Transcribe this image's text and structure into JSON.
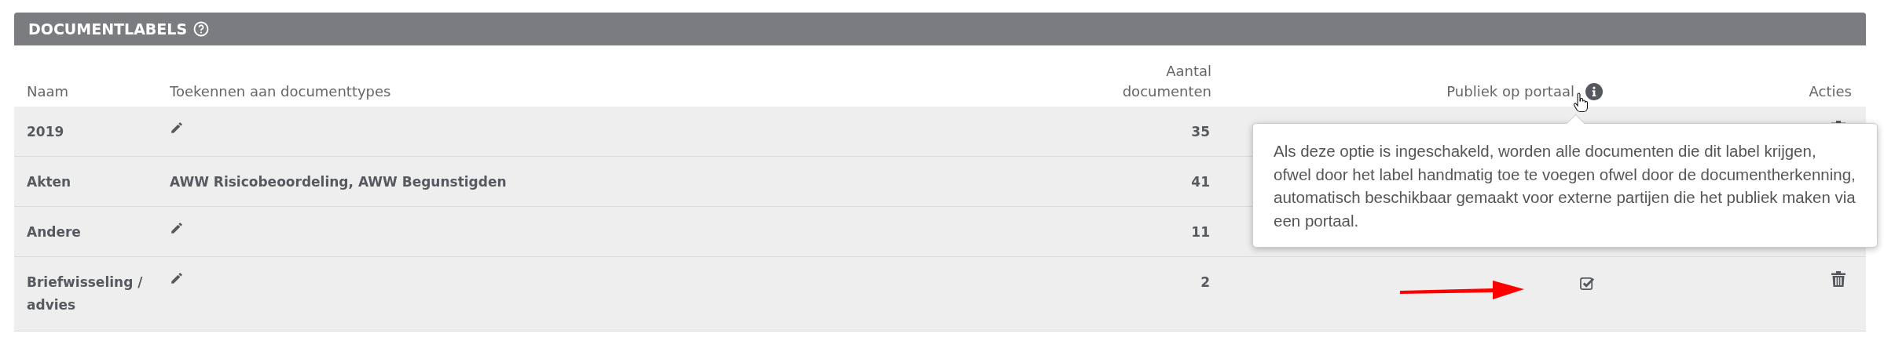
{
  "panel": {
    "title": "DOCUMENTLABELS"
  },
  "columns": {
    "name": "Naam",
    "types": "Toekennen aan documenttypes",
    "count_line_1": "Aantal",
    "count_line_2": "documenten",
    "public": "Publiek op portaal",
    "actions": "Acties"
  },
  "rows": [
    {
      "name": "2019",
      "count": "35",
      "delete_icon": true
    },
    {
      "name": "Akten",
      "types": "AWW Risicobeoordeling, AWW Begunstigden",
      "count": "41"
    },
    {
      "name": "Andere",
      "count": "11"
    },
    {
      "name": "Briefwisseling / advies",
      "count": "2",
      "public": true,
      "delete_icon": true
    }
  ],
  "tooltip": {
    "text": "Als deze optie is ingeschakeld, worden alle documenten die dit label krijgen, ofwel door het label handmatig toe te voegen ofwel door de documentherkenning, automatisch beschikbaar gemaakt voor externe partijen die het publiek maken via een portaal."
  }
}
